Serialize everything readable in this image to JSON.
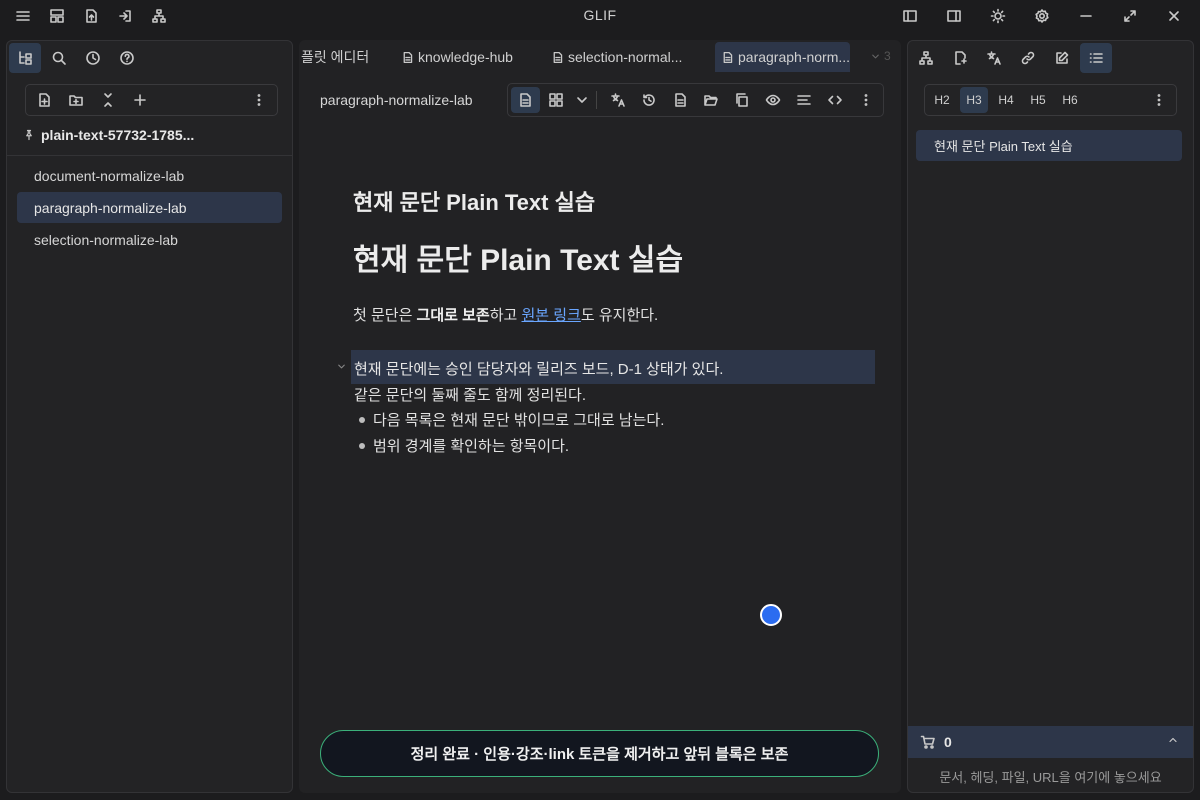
{
  "app": {
    "title": "GLIF"
  },
  "titlebar": {
    "left_icons": [
      "menu-icon",
      "layout-icon",
      "upload-icon",
      "login-icon",
      "sitemap-icon"
    ],
    "right_icons": [
      "left-sidebar-icon",
      "right-sidebar-icon",
      "sun-icon",
      "settings-icon",
      "minimize-icon",
      "maximize-icon",
      "close-icon"
    ]
  },
  "left_panel": {
    "tabs": [
      "file-tree-icon",
      "search-icon",
      "clock-icon",
      "help-icon"
    ],
    "toolbar_icons": [
      "new-file-icon",
      "new-folder-icon",
      "collapse-icon",
      "plus-icon",
      "more-icon"
    ],
    "vault_name": "plain-text-57732-1785...",
    "files": [
      {
        "label": "document-normalize-lab",
        "active": false
      },
      {
        "label": "paragraph-normalize-lab",
        "active": true
      },
      {
        "label": "selection-normalize-lab",
        "active": false
      }
    ]
  },
  "tabs": [
    {
      "label": "플릿 에디터",
      "icon": false,
      "active": false
    },
    {
      "label": "knowledge-hub",
      "icon": true,
      "active": false
    },
    {
      "label": "selection-normal...",
      "icon": true,
      "active": false
    },
    {
      "label": "paragraph-norm...",
      "icon": true,
      "active": true
    }
  ],
  "tab_overflow_count": "3",
  "editor": {
    "doc_title": "paragraph-normalize-lab",
    "toolbar_icons": [
      "document-icon",
      "grid-icon",
      "chevron-down-icon",
      "translate-icon",
      "history-icon",
      "file-text-icon",
      "folder-open-icon",
      "copy-icon",
      "eye-icon",
      "align-icon",
      "code-icon",
      "more-icon"
    ]
  },
  "document": {
    "h3": "현재 문단 Plain Text 실습",
    "h2": "현재 문단 Plain Text 실습",
    "para1": {
      "pre": "첫 문단은 ",
      "bold": "그대로 보존",
      "mid": "하고 ",
      "link": "원본 링크",
      "post": "도 유지한다."
    },
    "current_line1": "현재 문단에는 승인 담당자와 릴리즈 보드, D-1 상태가 있다.",
    "current_line2": "같은 문단의 둘째 줄도 함께 정리된다.",
    "bullets": [
      "다음 목록은 현재 문단 밖이므로 그대로 남는다.",
      "범위 경계를 확인하는 항목이다."
    ]
  },
  "toast": {
    "text": "정리 완료 · 인용·강조·link 토큰을 제거하고 앞뒤 블록은 보존"
  },
  "right_panel": {
    "tabs": [
      "graph-icon",
      "file-link-icon",
      "translate-icon",
      "link-icon",
      "edit-icon",
      "list-icon"
    ],
    "heading_levels": [
      "H2",
      "H3",
      "H4",
      "H5",
      "H6"
    ],
    "active_heading": "H3",
    "outline": [
      "현재 문단 Plain Text 실습"
    ],
    "cart_count": "0",
    "drop_hint": "문서, 헤딩, 파일, URL을 여기에 놓으세요"
  },
  "colors": {
    "accent": "#2b6cf0",
    "active_bg": "#2d3649",
    "toast_border": "#3bb07a",
    "link": "#6aa6ff"
  }
}
